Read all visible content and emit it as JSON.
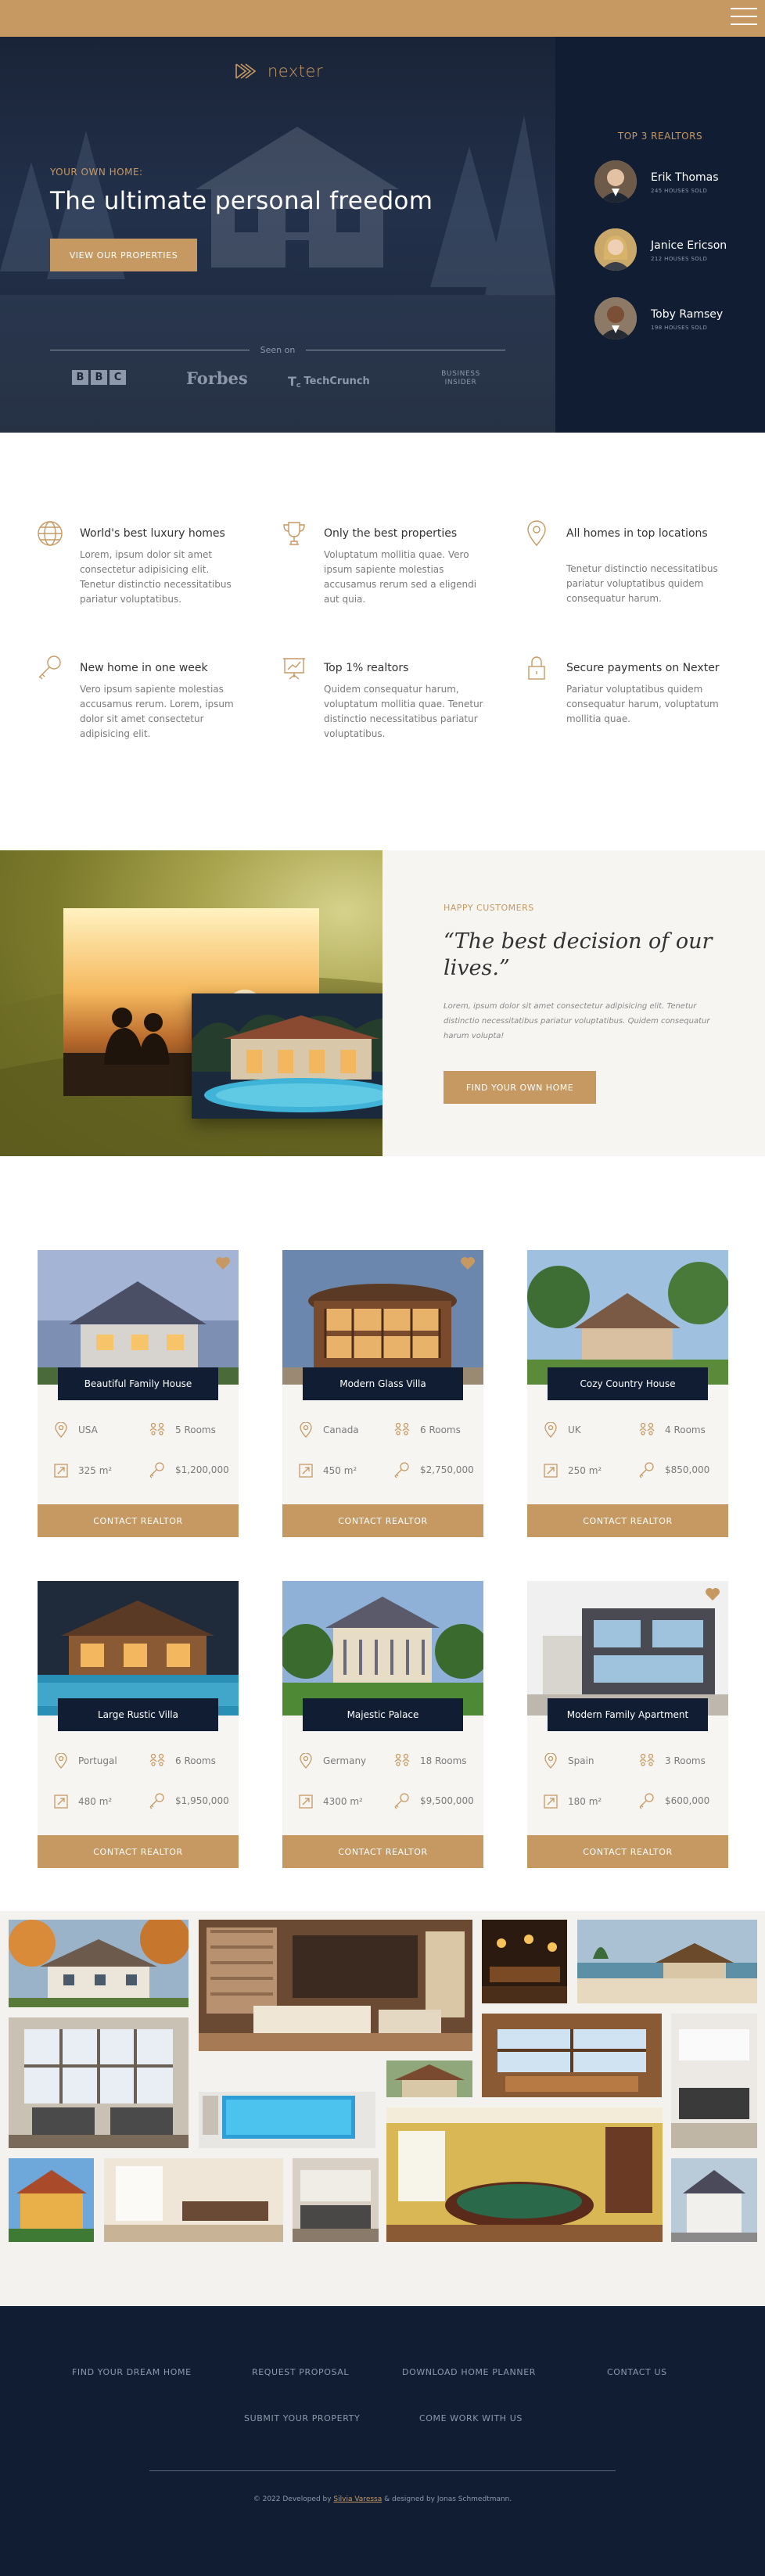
{
  "menu_label": "menu",
  "colors": {
    "accent": "#c69963",
    "navy": "#101d33",
    "light_bg": "#f7f5f2",
    "text_grey": "#7a7a7a"
  },
  "brand": {
    "name": "nexter"
  },
  "hero": {
    "subtitle": "YOUR OWN HOME:",
    "title": "The ultimate personal freedom",
    "cta": "VIEW OUR PROPERTIES",
    "seen_on": "Seen on",
    "brands": [
      "BBC",
      "Forbes",
      "TechCrunch",
      "BUSINESS INSIDER"
    ]
  },
  "realtors": {
    "title": "TOP 3 REALTORS",
    "items": [
      {
        "name": "Erik Thomas",
        "sold": "245 HOUSES SOLD"
      },
      {
        "name": "Janice Ericson",
        "sold": "212 HOUSES SOLD"
      },
      {
        "name": "Toby Ramsey",
        "sold": "198 HOUSES SOLD"
      }
    ]
  },
  "features": [
    {
      "icon": "globe-icon",
      "title": "World's best luxury homes",
      "text": "Lorem, ipsum dolor sit amet consectetur adipisicing elit. Tenetur distinctio necessitatibus pariatur voluptatibus."
    },
    {
      "icon": "trophy-icon",
      "title": "Only the best properties",
      "text": "Voluptatum mollitia quae. Vero ipsum sapiente molestias accusamus rerum sed a eligendi aut quia."
    },
    {
      "icon": "map-pin-icon",
      "title": "All homes in top locations",
      "text": "Tenetur distinctio necessitatibus pariatur voluptatibus quidem consequatur harum."
    },
    {
      "icon": "key-icon",
      "title": "New home in one week",
      "text": "Vero ipsum sapiente molestias accusamus rerum. Lorem, ipsum dolor sit amet consectetur adipisicing elit."
    },
    {
      "icon": "presentation-icon",
      "title": "Top 1% realtors",
      "text": "Quidem consequatur harum, voluptatum mollitia quae. Tenetur distinctio necessitatibus pariatur voluptatibus."
    },
    {
      "icon": "lock-icon",
      "title": "Secure payments on Nexter",
      "text": "Pariatur voluptatibus quidem consequatur harum, voluptatum mollitia quae."
    }
  ],
  "story": {
    "subtitle": "HAPPY CUSTOMERS",
    "quote": "“The best decision of our lives.”",
    "text": "Lorem, ipsum dolor sit amet consectetur adipisicing elit. Tenetur distinctio necessitatibus pariatur voluptatibus. Quidem consequatur harum volupta!",
    "cta": "FIND YOUR OWN HOME"
  },
  "homes": [
    {
      "name": "Beautiful Family House",
      "country": "USA",
      "rooms": "5 Rooms",
      "area": "325 m²",
      "price": "$1,200,000",
      "cta": "CONTACT REALTOR",
      "favorite": true
    },
    {
      "name": "Modern Glass Villa",
      "country": "Canada",
      "rooms": "6 Rooms",
      "area": "450 m²",
      "price": "$2,750,000",
      "cta": "CONTACT REALTOR",
      "favorite": true
    },
    {
      "name": "Cozy Country House",
      "country": "UK",
      "rooms": "4 Rooms",
      "area": "250 m²",
      "price": "$850,000",
      "cta": "CONTACT REALTOR",
      "favorite": false
    },
    {
      "name": "Large Rustic Villa",
      "country": "Portugal",
      "rooms": "6 Rooms",
      "area": "480 m²",
      "price": "$1,950,000",
      "cta": "CONTACT REALTOR",
      "favorite": false
    },
    {
      "name": "Majestic Palace",
      "country": "Germany",
      "rooms": "18 Rooms",
      "area": "4300 m²",
      "price": "$9,500,000",
      "cta": "CONTACT REALTOR",
      "favorite": false
    },
    {
      "name": "Modern Family Apartment",
      "country": "Spain",
      "rooms": "3 Rooms",
      "area": "180 m²",
      "price": "$600,000",
      "cta": "CONTACT REALTOR",
      "favorite": true
    }
  ],
  "footer": {
    "links": [
      "FIND YOUR DREAM HOME",
      "REQUEST PROPOSAL",
      "DOWNLOAD HOME PLANNER",
      "CONTACT US",
      "SUBMIT YOUR PROPERTY",
      "COME WORK WITH US"
    ],
    "copyright_prefix": "© 2022 Developed by ",
    "author": "Silvia Varessa",
    "copyright_suffix": " & designed by Jonas Schmedtmann."
  }
}
